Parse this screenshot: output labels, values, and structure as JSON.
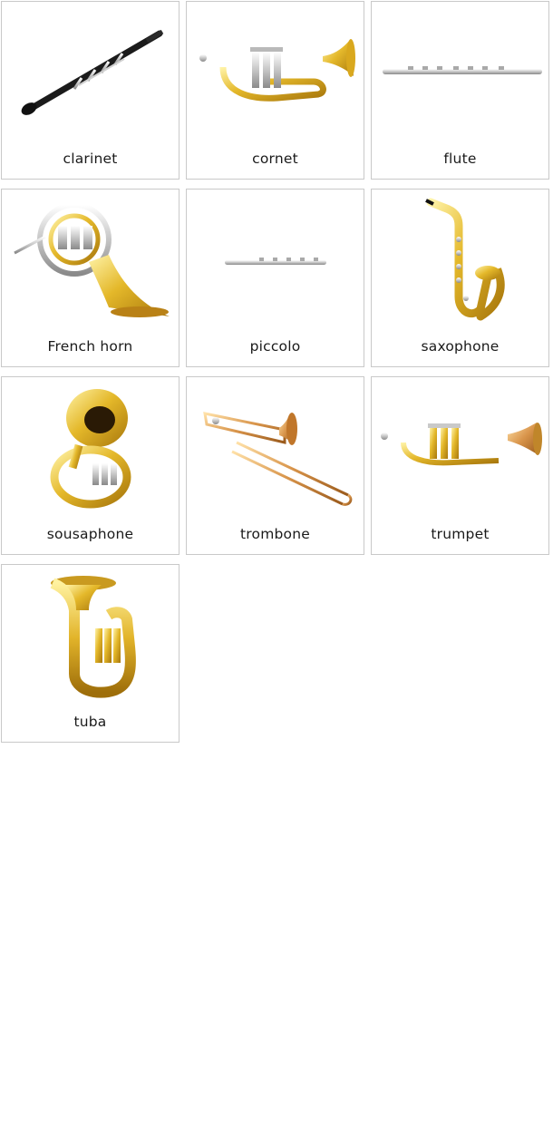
{
  "cards": [
    {
      "label": "clarinet",
      "icon": "clarinet-icon"
    },
    {
      "label": "cornet",
      "icon": "cornet-icon"
    },
    {
      "label": "flute",
      "icon": "flute-icon"
    },
    {
      "label": "French horn",
      "icon": "french-horn-icon"
    },
    {
      "label": "piccolo",
      "icon": "piccolo-icon"
    },
    {
      "label": "saxophone",
      "icon": "saxophone-icon"
    },
    {
      "label": "sousaphone",
      "icon": "sousaphone-icon"
    },
    {
      "label": "trombone",
      "icon": "trombone-icon"
    },
    {
      "label": "trumpet",
      "icon": "trumpet-icon"
    },
    {
      "label": "tuba",
      "icon": "tuba-icon"
    }
  ],
  "colors": {
    "brass": "#e2b52c",
    "silver": "#cfcfcf",
    "black": "#1b1b1b",
    "border": "#c9c9c9"
  }
}
